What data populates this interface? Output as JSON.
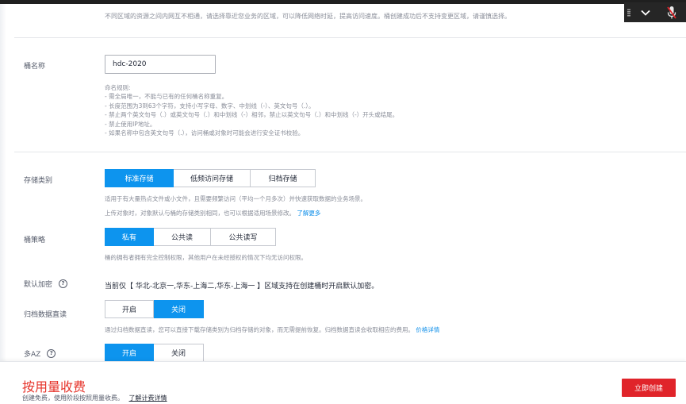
{
  "region": {
    "hint": "不同区域的资源之间内网互不相通，请选择靠近您业务的区域，可以降低网络时延，提高访问速度。桶创建成功后不支持变更区域，请谨慎选择。"
  },
  "bucket_name": {
    "label": "桶名称",
    "value": "hdc-2020",
    "rules": [
      "命名规则:",
      "- 需全局唯一，不能与已有的任何桶名称重复。",
      "- 长度范围为3到63个字符，支持小写字母、数字、中划线（-）、英文句号（.）。",
      "- 禁止两个英文句号（.）或英文句号（.）和中划线（-）相邻，禁止以英文句号（.）和中划线（-）开头或结尾。",
      "- 禁止使用IP地址。",
      "- 如果名称中包含英文句号（.），访问桶或对象时可能会进行安全证书校验。"
    ]
  },
  "storage_class": {
    "label": "存储类别",
    "options": [
      "标准存储",
      "低频访问存储",
      "归档存储"
    ],
    "selected": 0,
    "desc1": "适用于有大量热点文件或小文件，且需要频繁访问（平均一个月多次）并快速获取数据的业务场景。",
    "desc2": "上传对象时，对象默认与桶的存储类别相同，也可以根据适用场景修改。",
    "desc2_link": "了解更多"
  },
  "bucket_policy": {
    "label": "桶策略",
    "options": [
      "私有",
      "公共读",
      "公共读写"
    ],
    "selected": 0,
    "desc": "桶的拥有者拥有完全控制权限，其他用户在未经授权的情况下均无访问权限。"
  },
  "encryption": {
    "label": "默认加密",
    "help_icon": "?",
    "text": "当前仅【 华北-北京一,华东-上海二,华东-上海一 】区域支持在创建桶时开启默认加密。"
  },
  "archive_read": {
    "label": "归档数据直读",
    "options": [
      "开启",
      "关闭"
    ],
    "selected": 1,
    "desc": "通过归档数据直读，您可以直接下载存储类别为归档存储的对象，而无需提前恢复。归档数据直读会收取相应的费用。",
    "desc_link": "价格详情"
  },
  "multi_az": {
    "label": "多AZ",
    "help_icon": "?",
    "options": [
      "开启",
      "关闭"
    ],
    "selected": 0
  },
  "footer": {
    "price_title": "按用量收费",
    "price_desc": "创建免费，使用阶段按照用量收费。",
    "price_link": "了解计费详情",
    "create_label": "立即创建"
  },
  "colors": {
    "accent": "#0d94ee",
    "danger": "#e0242a",
    "price": "#e6332a"
  },
  "icons": {
    "float_bar": [
      "drag-handle-icon",
      "chevron-down-icon",
      "microphone-muted-icon"
    ]
  }
}
